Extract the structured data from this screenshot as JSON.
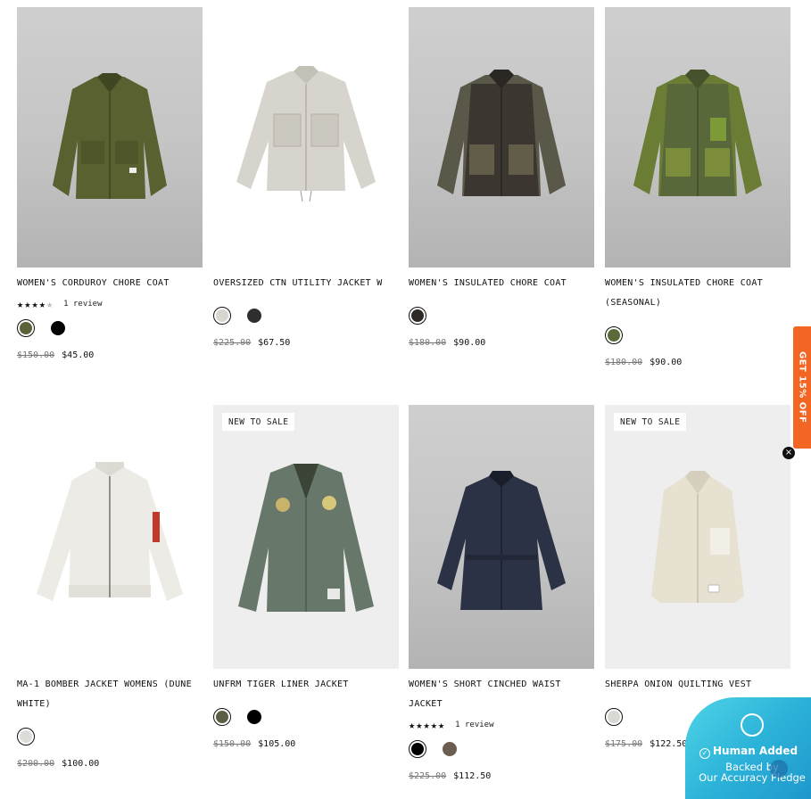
{
  "products": [
    {
      "title": "WOMEN'S CORDUROY CHORE COAT",
      "badge": "",
      "rating": {
        "stars": 4,
        "label": "1 review"
      },
      "swatches": [
        "#5a6238",
        "#000000"
      ],
      "price_old": "$150.00",
      "price_new": "$45.00"
    },
    {
      "title": "OVERSIZED CTN UTILITY JACKET W",
      "badge": "",
      "swatches": [
        "#d8d6cf",
        "#2e2e2e"
      ],
      "price_old": "$225.00",
      "price_new": "$67.50"
    },
    {
      "title": "WOMEN'S INSULATED CHORE COAT",
      "badge": "",
      "swatches": [
        "#2e2a26"
      ],
      "price_old": "$180.00",
      "price_new": "$90.00"
    },
    {
      "title": "WOMEN'S INSULATED CHORE COAT (SEASONAL)",
      "badge": "",
      "swatches": [
        "#5a6a3a"
      ],
      "price_old": "$180.00",
      "price_new": "$90.00"
    },
    {
      "title": "MA-1 BOMBER JACKET WOMENS (DUNE WHITE)",
      "badge": "",
      "swatches": [
        "#dcdcd8"
      ],
      "price_old": "$200.00",
      "price_new": "$100.00"
    },
    {
      "title": "UNFRM TIGER LINER JACKET",
      "badge": "NEW TO SALE",
      "swatches": [
        "#5a5f45",
        "#000000"
      ],
      "price_old": "$150.00",
      "price_new": "$105.00"
    },
    {
      "title": "WOMEN'S SHORT CINCHED WAIST JACKET",
      "badge": "",
      "rating": {
        "stars": 5,
        "label": "1 review"
      },
      "swatches": [
        "#000000",
        "#6b5e50"
      ],
      "price_old": "$225.00",
      "price_new": "$112.50"
    },
    {
      "title": "SHERPA ONION QUILTING VEST",
      "badge": "NEW TO SALE",
      "swatches": [
        "#d9d9d4"
      ],
      "price_old": "$175.00",
      "price_new": "$122.50"
    }
  ],
  "side_tab": {
    "label": "GET 15% OFF"
  },
  "trust_badge": {
    "title": "Human Added",
    "subtitle_1": "Backed by",
    "subtitle_2": "Our Accuracy Pledge"
  },
  "close_label": "×"
}
